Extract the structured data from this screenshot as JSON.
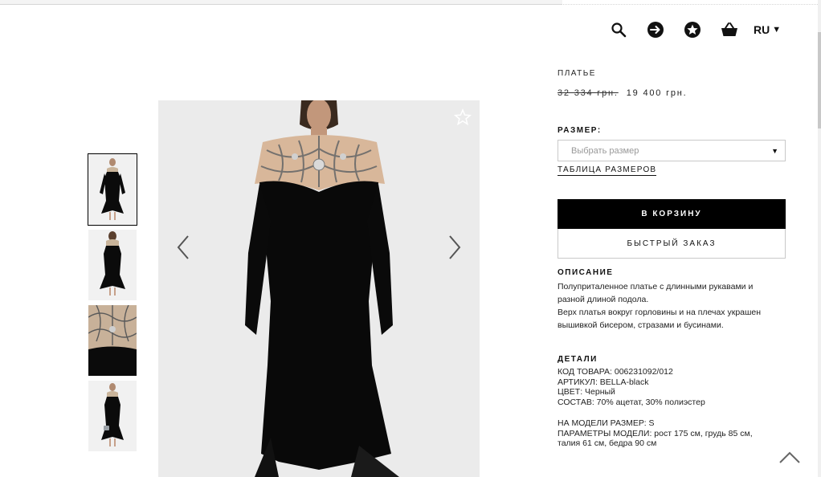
{
  "header": {
    "icons": [
      "search-icon",
      "login-icon",
      "favorites-star-icon",
      "basket-icon"
    ],
    "language": "RU"
  },
  "gallery": {
    "thumbnails": [
      "thumb-front",
      "thumb-back",
      "thumb-detail",
      "thumb-with-bag"
    ],
    "active_thumbnail": 0
  },
  "product": {
    "type": "ПЛАТЬЕ",
    "old_price": "32 334 грн.",
    "new_price": "19 400 грн.",
    "size_label": "РАЗМЕР:",
    "size_placeholder": "Выбрать размер",
    "size_table_link": "ТАБЛИЦА РАЗМЕРОВ",
    "add_to_cart": "В КОРЗИНУ",
    "quick_order": "БЫСТРЫЙ ЗАКАЗ"
  },
  "description": {
    "title": "ОПИСАНИЕ",
    "lines": [
      "Полуприталенное платье с длинными рукавами и",
      "разной длиной подола.",
      "Верх платья вокруг горловины и на плечах украшен",
      "вышивкой бисером, стразами и бусинами."
    ]
  },
  "details": {
    "title": "ДЕТАЛИ",
    "lines": [
      "КОД ТОВАРА: 006231092/012",
      "АРТИКУЛ: BELLA-black",
      "ЦВЕТ: Черный",
      "СОСТАВ: 70% ацетат, 30% полиэстер"
    ],
    "model_lines": [
      "НА МОДЕЛИ РАЗМЕР: S",
      "ПАРАМЕТРЫ МОДЕЛИ: рост 175 см, грудь 85 см,",
      "талия 61 см, бедра 90 см"
    ]
  }
}
